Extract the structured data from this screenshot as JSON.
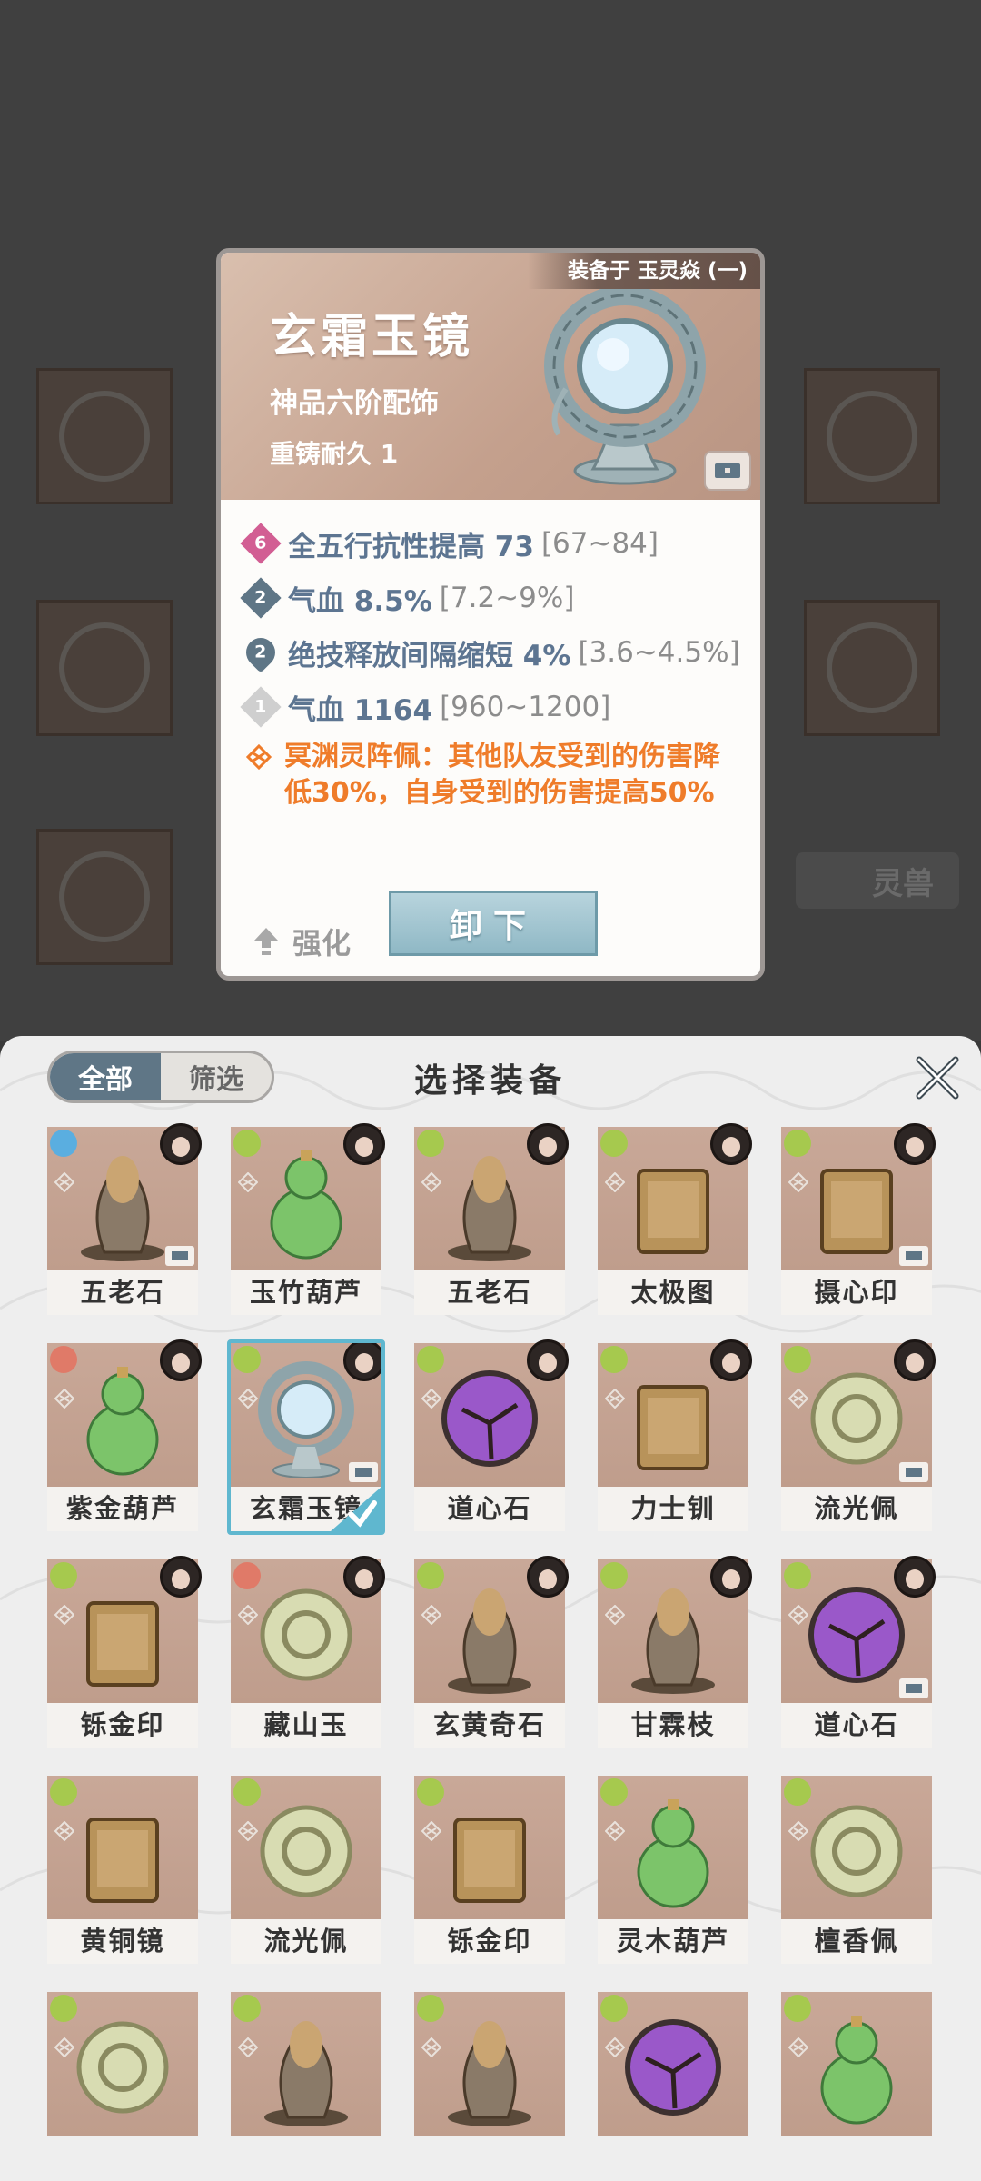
{
  "popup": {
    "equipped_on": "装备于 玉灵焱 (一)",
    "name": "玄霜玉镜",
    "grade": "神品六阶配饰",
    "recast": "重铸耐久 1",
    "attributes": [
      {
        "badge": "6",
        "badge_color": "#d25e93",
        "main": "全五行抗性提高 73",
        "range": "[67~84]"
      },
      {
        "badge": "2",
        "badge_color": "#5f7686",
        "main": "气血 8.5%",
        "range": "[7.2~9%]"
      },
      {
        "badge": "2",
        "badge_color": "#5f7686",
        "main": "绝技释放间隔缩短 4%",
        "range": "[3.6~4.5%]"
      },
      {
        "badge": "1",
        "badge_color": "#cfcfcf",
        "main": "气血 1164",
        "range": "[960~1200]"
      }
    ],
    "special_line1": "冥渊灵阵佩：其他队友受到的伤害降",
    "special_line2": "低30%，自身受到的伤害提高50%",
    "enhance_label": "强化",
    "unequip_label": "卸下"
  },
  "background": {
    "beast_tab": "灵兽"
  },
  "panel": {
    "title": "选择装备",
    "filter_all": "全部",
    "filter_screen": "筛选",
    "items": [
      {
        "name": "五老石",
        "elem_color": "#5aaee0",
        "chest": true
      },
      {
        "name": "玉竹葫芦",
        "elem_color": "#a6c94e",
        "chest": false
      },
      {
        "name": "五老石",
        "elem_color": "#a6c94e",
        "chest": false
      },
      {
        "name": "太极图",
        "elem_color": "#a6c94e",
        "chest": false
      },
      {
        "name": "摄心印",
        "elem_color": "#a6c94e",
        "chest": true
      },
      {
        "name": "紫金葫芦",
        "elem_color": "#e07a68",
        "chest": false
      },
      {
        "name": "玄霜玉镜",
        "elem_color": "#a6c94e",
        "chest": true,
        "selected": true
      },
      {
        "name": "道心石",
        "elem_color": "#a6c94e",
        "chest": false
      },
      {
        "name": "力士钏",
        "elem_color": "#a6c94e",
        "chest": false
      },
      {
        "name": "流光佩",
        "elem_color": "#a6c94e",
        "chest": true
      },
      {
        "name": "铄金印",
        "elem_color": "#a6c94e",
        "chest": false
      },
      {
        "name": "藏山玉",
        "elem_color": "#e07a68",
        "chest": false
      },
      {
        "name": "玄黄奇石",
        "elem_color": "#a6c94e",
        "chest": false
      },
      {
        "name": "甘霖枝",
        "elem_color": "#a6c94e",
        "chest": false
      },
      {
        "name": "道心石",
        "elem_color": "#a6c94e",
        "chest": true
      },
      {
        "name": "黄铜镜",
        "elem_color": "#a6c94e",
        "chest": false
      },
      {
        "name": "流光佩",
        "elem_color": "#a6c94e",
        "chest": false
      },
      {
        "name": "铄金印",
        "elem_color": "#a6c94e",
        "chest": false
      },
      {
        "name": "灵木葫芦",
        "elem_color": "#a6c94e",
        "chest": false
      },
      {
        "name": "檀香佩",
        "elem_color": "#a6c94e",
        "chest": false
      },
      {
        "name": "",
        "elem_color": "#a6c94e",
        "chest": false
      },
      {
        "name": "",
        "elem_color": "#a6c94e",
        "chest": false
      },
      {
        "name": "",
        "elem_color": "#a6c94e",
        "chest": false
      },
      {
        "name": "",
        "elem_color": "#a6c94e",
        "chest": false
      },
      {
        "name": "",
        "elem_color": "#a6c94e",
        "chest": false
      }
    ]
  },
  "colors": {
    "accent": "#5f7686",
    "special_text": "#ef7c2a",
    "selected_border": "#5fb7cf"
  }
}
